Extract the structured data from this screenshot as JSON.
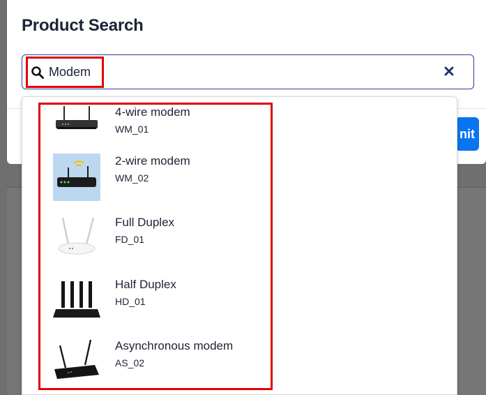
{
  "modal": {
    "title": "Product Search",
    "submit_label": "nit"
  },
  "search": {
    "value": "Modem",
    "clear_icon": "close-icon",
    "search_icon": "search-icon"
  },
  "results": [
    {
      "name": "4-wire modem",
      "code": "WM_01",
      "image": "router-image"
    },
    {
      "name": "2-wire modem",
      "code": "WM_02",
      "image": "wifi-router-image"
    },
    {
      "name": "Full Duplex",
      "code": "FD_01",
      "image": "white-router-image"
    },
    {
      "name": "Half Duplex",
      "code": "HD_01",
      "image": "four-antenna-router-image"
    },
    {
      "name": "Asynchronous modem",
      "code": "AS_02",
      "image": "two-antenna-router-image"
    }
  ],
  "colors": {
    "accent": "#0b74f0",
    "highlight": "#e00000",
    "text": "#1c2333",
    "input_border": "#2f3e9e"
  }
}
